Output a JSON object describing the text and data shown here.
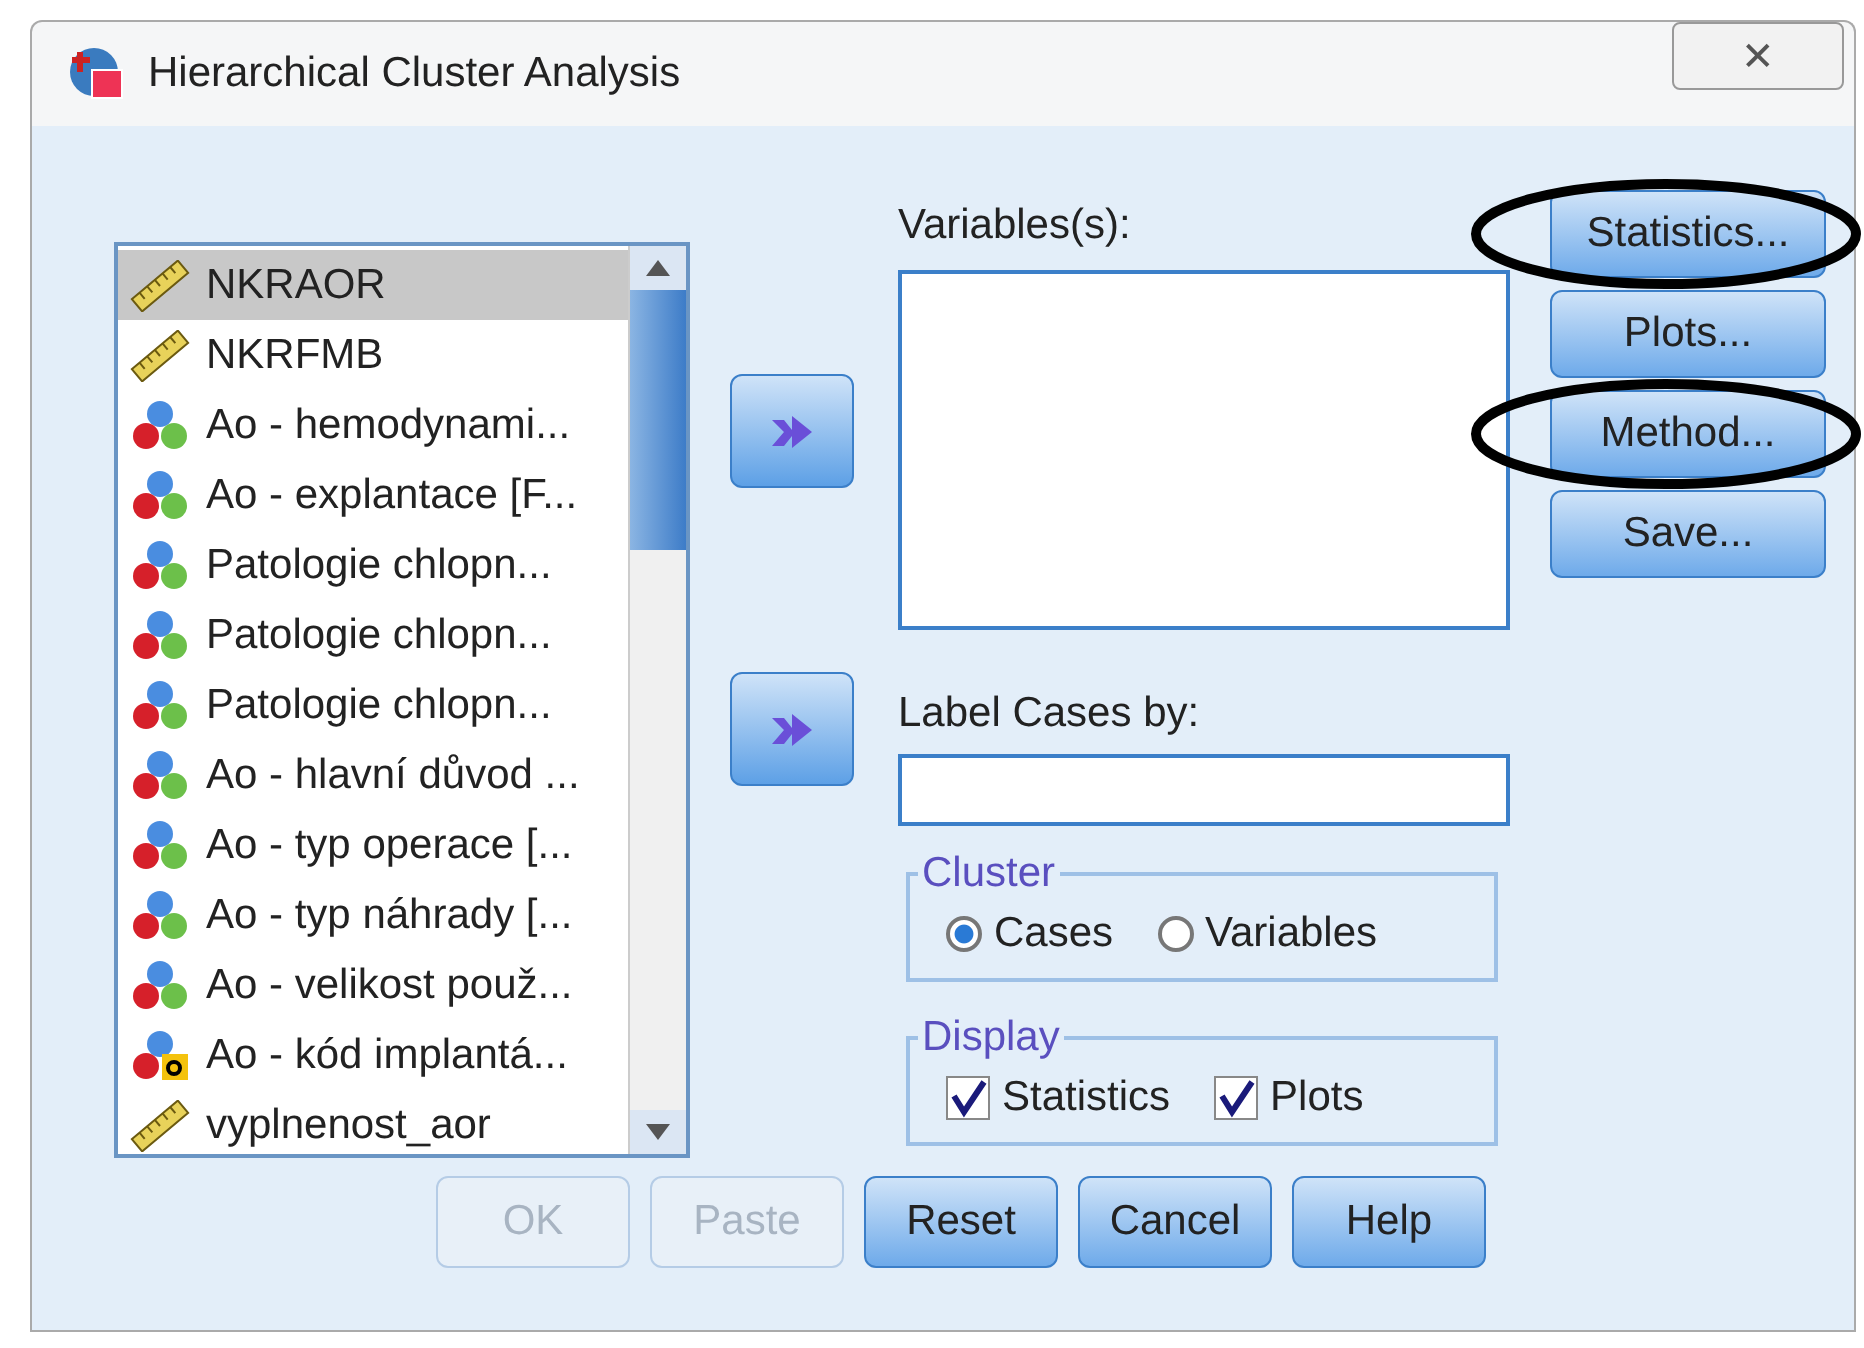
{
  "window": {
    "title": "Hierarchical Cluster Analysis",
    "close": "✕"
  },
  "variable_list": {
    "items": [
      {
        "label": "NKRAOR",
        "kind": "scale",
        "selected": true
      },
      {
        "label": "NKRFMB",
        "kind": "scale",
        "selected": false
      },
      {
        "label": "Ao - hemodynami...",
        "kind": "nominal",
        "selected": false
      },
      {
        "label": "Ao - explantace [F...",
        "kind": "nominal",
        "selected": false
      },
      {
        "label": "Patologie chlopn...",
        "kind": "nominal",
        "selected": false
      },
      {
        "label": "Patologie chlopn...",
        "kind": "nominal",
        "selected": false
      },
      {
        "label": "Patologie chlopn...",
        "kind": "nominal",
        "selected": false
      },
      {
        "label": "Ao - hlavní důvod ...",
        "kind": "nominal",
        "selected": false
      },
      {
        "label": "Ao - typ operace [...",
        "kind": "nominal",
        "selected": false
      },
      {
        "label": "Ao - typ náhrady [...",
        "kind": "nominal",
        "selected": false
      },
      {
        "label": "Ao - velikost použ...",
        "kind": "nominal",
        "selected": false
      },
      {
        "label": "Ao - kód implantá...",
        "kind": "string",
        "selected": false
      },
      {
        "label": "vyplnenost_aor",
        "kind": "scale",
        "selected": false
      }
    ]
  },
  "variables": {
    "label": "Variables(s):"
  },
  "label_cases": {
    "label": "Label Cases by:"
  },
  "cluster": {
    "title": "Cluster",
    "options": [
      {
        "label": "Cases",
        "selected": true
      },
      {
        "label": "Variables",
        "selected": false
      }
    ]
  },
  "display": {
    "title": "Display",
    "options": [
      {
        "label": "Statistics",
        "checked": true
      },
      {
        "label": "Plots",
        "checked": true
      }
    ]
  },
  "side_buttons": [
    {
      "label": "Statistics...",
      "circled": true
    },
    {
      "label": "Plots...",
      "circled": false
    },
    {
      "label": "Method...",
      "circled": true
    },
    {
      "label": "Save...",
      "circled": false
    }
  ],
  "bottom_buttons": [
    {
      "label": "OK",
      "disabled": true
    },
    {
      "label": "Paste",
      "disabled": true
    },
    {
      "label": "Reset",
      "disabled": false
    },
    {
      "label": "Cancel",
      "disabled": false
    },
    {
      "label": "Help",
      "disabled": false
    }
  ]
}
